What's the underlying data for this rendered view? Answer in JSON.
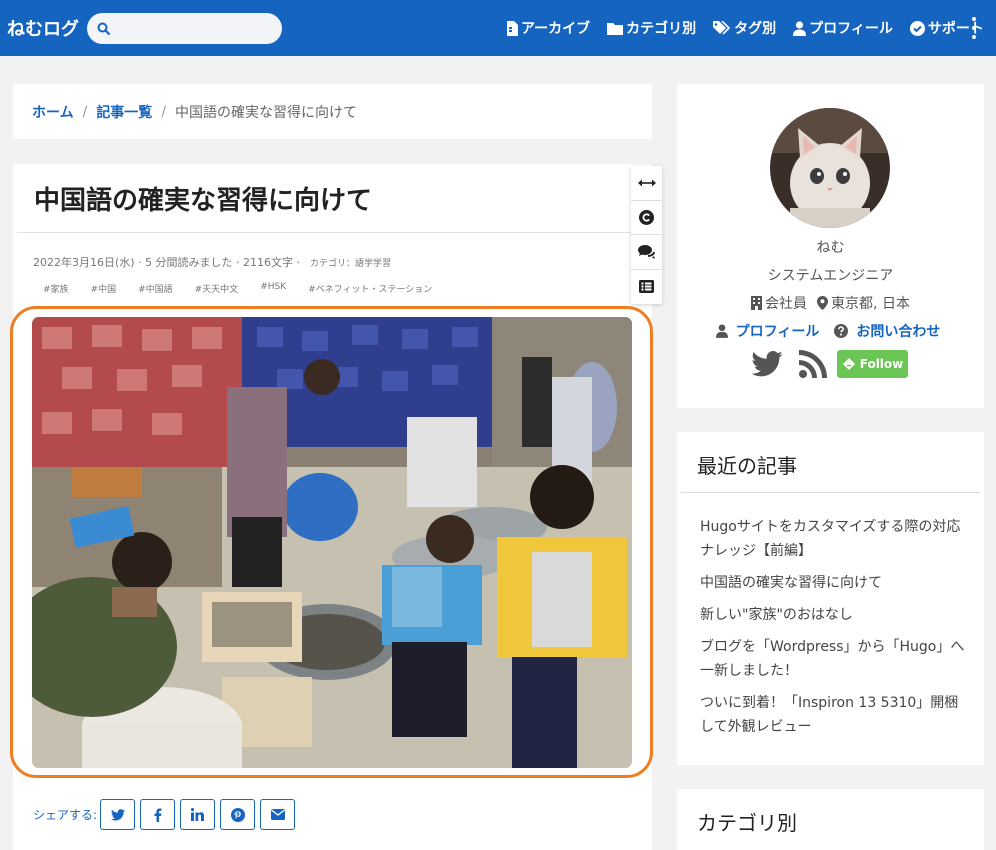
{
  "navbar": {
    "brand": "ねむログ",
    "search_placeholder": "",
    "items": [
      {
        "label": "アーカイブ",
        "icon": "archive-file-icon"
      },
      {
        "label": "カテゴリ別",
        "icon": "folder-icon"
      },
      {
        "label": "タグ別",
        "icon": "tags-icon"
      },
      {
        "label": "プロフィール",
        "icon": "user-icon"
      },
      {
        "label": "サポート",
        "icon": "check-circle-icon"
      }
    ],
    "accent": "#1565c0"
  },
  "breadcrumb": {
    "items": [
      "ホーム",
      "記事一覧"
    ],
    "separator": "/",
    "current": "中国語の確実な習得に向けて"
  },
  "article": {
    "title": "中国語の確実な習得に向けて",
    "meta": "2022年3月16日(水) · 5 分間読みました · 2116文字 ·",
    "category": "カテゴリ：語学学習",
    "tags": [
      "#家族",
      "#中国",
      "#中国語",
      "#天天中文",
      "#HSK",
      "#ベネフィット・ステーション"
    ],
    "hero_icon": "market-photo",
    "highlight_color": "#ef7d22",
    "share_label": "シェアする:",
    "share_buttons": [
      "twitter-icon",
      "facebook-icon",
      "linkedin-icon",
      "pinterest-icon",
      "mail-icon"
    ]
  },
  "float_toolbar": [
    "expand-width-icon",
    "copyright-icon",
    "comments-icon",
    "list-icon"
  ],
  "profile": {
    "name": "ねむ",
    "role": "システムエンジニア",
    "company": "会社員",
    "location": "東京都, 日本",
    "links": [
      "プロフィール",
      "お問い合わせ"
    ],
    "feedly_label": "Follow"
  },
  "recent": {
    "title": "最近の記事",
    "items": [
      "Hugoサイトをカスタマイズする際の対応ナレッジ【前編】",
      "中国語の確実な習得に向けて",
      "新しい\"家族\"のおはなし",
      "ブログを「Wordpress」から「Hugo」へ一新しました！",
      "ついに到着！「Inspiron 13 5310」開梱して外観レビュー"
    ]
  },
  "categories": {
    "title": "カテゴリ別"
  }
}
